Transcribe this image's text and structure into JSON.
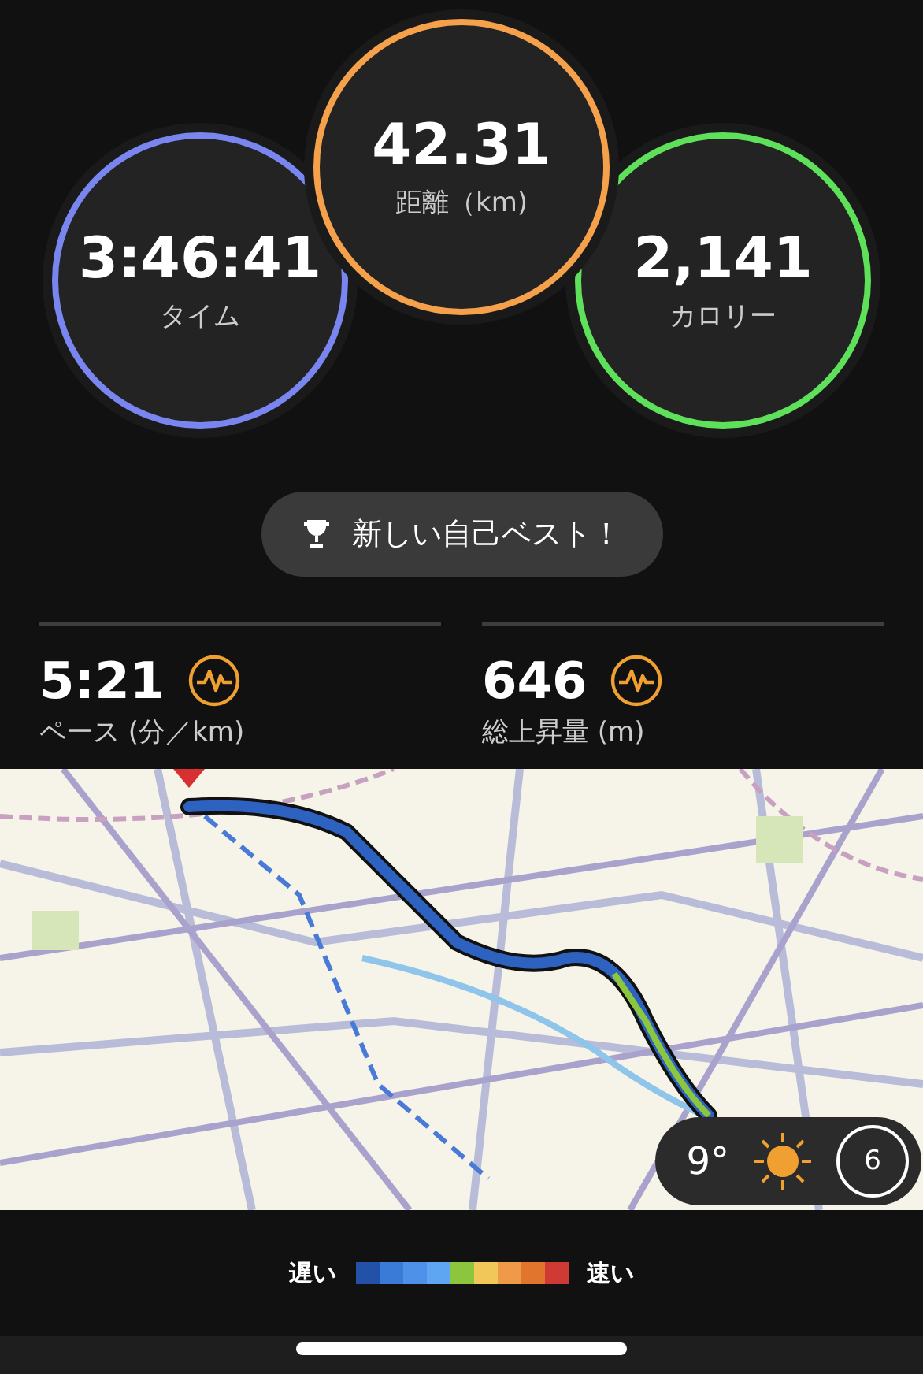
{
  "rings": [
    {
      "value": "3:46:41",
      "label": "タイム",
      "color": "#7a86f0"
    },
    {
      "value": "42.31",
      "label": "距離（km)",
      "color": "#f5a04a"
    },
    {
      "value": "2,141",
      "label": "カロリー",
      "color": "#5fe05a"
    }
  ],
  "badge": {
    "text": "新しい自己ベスト！"
  },
  "stats": [
    {
      "value": "5:21",
      "label": "ペース (分／km)"
    },
    {
      "value": "646",
      "label": "総上昇量 (m)"
    }
  ],
  "map": {
    "kind": "picture",
    "weather": {
      "temperature": "9°",
      "wind": "6"
    }
  },
  "legend": {
    "slow": "遅い",
    "fast": "速い",
    "segments": [
      {
        "color": "#2451a8"
      },
      {
        "color": "#3a7bd8"
      },
      {
        "color": "#4d92e8"
      },
      {
        "color": "#5ea5f2"
      },
      {
        "color": "#8cc63f"
      },
      {
        "color": "#f2c75a"
      },
      {
        "color": "#ee9a48"
      },
      {
        "color": "#e2752e"
      },
      {
        "color": "#cf3b34"
      }
    ]
  }
}
